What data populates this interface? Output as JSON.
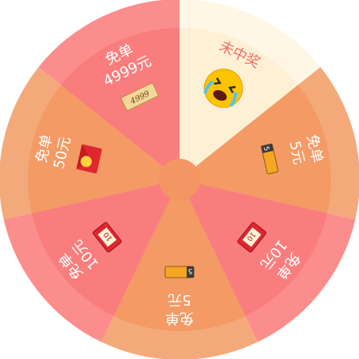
{
  "wheel": {
    "colors": {
      "outer_orange": "#f4a97a",
      "inner_orange": "#f39a65",
      "outer_pink": "#fb8d8c",
      "inner_pink": "#fa7d7d",
      "outer_cream": "#fff6e6",
      "inner_cream": "#fdf0d5",
      "hub": "#f39663",
      "label_white": "#ffffff",
      "label_red": "#f07069"
    },
    "segments": [
      {
        "id": "no-prize",
        "line1": "未中奖",
        "line2": "",
        "icon": "crying-emoji-icon",
        "tone": "cream"
      },
      {
        "id": "free-5-a",
        "line1": "免单",
        "line2": "5元",
        "icon": "coupon-5-icon",
        "tone": "orange"
      },
      {
        "id": "free-10-a",
        "line1": "免单",
        "line2": "10元",
        "icon": "coupon-10-icon",
        "tone": "pink"
      },
      {
        "id": "free-5-b",
        "line1": "免单",
        "line2": "5元",
        "icon": "coupon-5-icon",
        "tone": "orange"
      },
      {
        "id": "free-10-b",
        "line1": "免单",
        "line2": "10元",
        "icon": "coupon-10-icon",
        "tone": "pink"
      },
      {
        "id": "free-50",
        "line1": "免单",
        "line2": "50元",
        "icon": "red-envelope-icon",
        "tone": "orange"
      },
      {
        "id": "free-4999",
        "line1": "免单",
        "line2": "4999元",
        "icon": "ticket-4999-icon",
        "tone": "pink"
      }
    ],
    "icon_text": {
      "coupon5": "5",
      "coupon10": "10",
      "ticket4999": "4999"
    }
  }
}
